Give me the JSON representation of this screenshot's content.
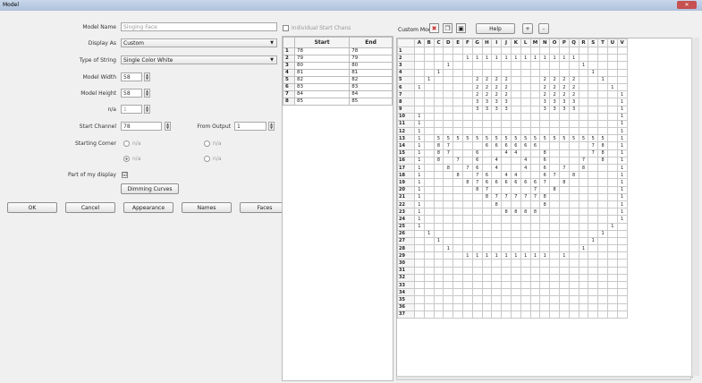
{
  "window": {
    "title": "Model",
    "close": "✕"
  },
  "form": {
    "model_name_label": "Model Name",
    "model_name_value": "Singing Face",
    "display_as_label": "Display As",
    "display_as_value": "Custom",
    "string_type_label": "Type of String",
    "string_type_value": "Single Color White",
    "width_label": "Model Width",
    "width_value": "58",
    "height_label": "Model Height",
    "height_value": "58",
    "na_label": "n/a",
    "na_value": "1",
    "start_channel_label": "Start Channel",
    "start_channel_value": "78",
    "from_output_label": "From Output",
    "from_output_value": "1",
    "starting_corner_label": "Starting Corner",
    "radio_na": "n/a",
    "part_of_display_label": "Part of my display",
    "part_of_display_check": "☑",
    "dimming_button": "Dimming Curves",
    "individual_start_label": "Individual Start Chans"
  },
  "buttons": {
    "ok": "OK",
    "cancel": "Cancel",
    "appearance": "Appearance",
    "names": "Names",
    "faces": "Faces"
  },
  "start_table": {
    "headers": [
      "",
      "Start",
      "End"
    ],
    "rows": [
      [
        "1",
        "78",
        "78"
      ],
      [
        "2",
        "79",
        "79"
      ],
      [
        "3",
        "80",
        "80"
      ],
      [
        "4",
        "81",
        "81"
      ],
      [
        "5",
        "82",
        "82"
      ],
      [
        "6",
        "83",
        "83"
      ],
      [
        "7",
        "84",
        "84"
      ],
      [
        "8",
        "85",
        "85"
      ]
    ]
  },
  "custom": {
    "label": "Custom Model",
    "help": "Help",
    "plus": "+",
    "minus": "-",
    "columns": [
      "A",
      "B",
      "C",
      "D",
      "E",
      "F",
      "G",
      "H",
      "I",
      "J",
      "K",
      "L",
      "M",
      "N",
      "O",
      "P",
      "Q",
      "R",
      "S",
      "T",
      "U",
      "V"
    ],
    "rows": [
      {
        "n": "1",
        "cells": {}
      },
      {
        "n": "2",
        "cells": {
          "F": "1",
          "G": "1",
          "H": "1",
          "I": "1",
          "J": "1",
          "K": "1",
          "L": "1",
          "M": "1",
          "N": "1",
          "O": "1",
          "P": "1",
          "Q": "1"
        }
      },
      {
        "n": "3",
        "cells": {
          "D": "1",
          "R": "1"
        }
      },
      {
        "n": "4",
        "cells": {
          "C": "1",
          "S": "1"
        }
      },
      {
        "n": "5",
        "cells": {
          "B": "1",
          "G": "2",
          "H": "2",
          "I": "2",
          "J": "2",
          "N": "2",
          "O": "2",
          "P": "2",
          "Q": "2",
          "T": "1"
        }
      },
      {
        "n": "6",
        "cells": {
          "A": "1",
          "G": "2",
          "H": "2",
          "I": "2",
          "J": "2",
          "N": "2",
          "O": "2",
          "P": "2",
          "Q": "2",
          "U": "1"
        }
      },
      {
        "n": "7",
        "cells": {
          "G": "2",
          "H": "2",
          "I": "2",
          "J": "2",
          "N": "2",
          "O": "2",
          "P": "2",
          "Q": "2",
          "V": "1"
        }
      },
      {
        "n": "8",
        "cells": {
          "G": "3",
          "H": "3",
          "I": "3",
          "J": "3",
          "N": "3",
          "O": "3",
          "P": "3",
          "Q": "3",
          "V": "1"
        }
      },
      {
        "n": "9",
        "cells": {
          "G": "3",
          "H": "3",
          "I": "3",
          "J": "3",
          "N": "3",
          "O": "3",
          "P": "3",
          "Q": "3",
          "V": "1"
        }
      },
      {
        "n": "10",
        "cells": {
          "A": "1",
          "V": "1"
        }
      },
      {
        "n": "11",
        "cells": {
          "A": "1",
          "V": "1"
        }
      },
      {
        "n": "12",
        "cells": {
          "A": "1",
          "V": "1"
        }
      },
      {
        "n": "13",
        "cells": {
          "A": "1",
          "C": "5",
          "D": "5",
          "E": "5",
          "F": "5",
          "G": "5",
          "H": "5",
          "I": "5",
          "J": "5",
          "K": "5",
          "L": "5",
          "M": "5",
          "N": "5",
          "O": "5",
          "P": "5",
          "Q": "5",
          "R": "5",
          "S": "5",
          "T": "5",
          "V": "1"
        }
      },
      {
        "n": "14",
        "cells": {
          "A": "1",
          "C": "8",
          "D": "7",
          "H": "6",
          "I": "6",
          "J": "6",
          "K": "6",
          "L": "6",
          "M": "6",
          "S": "7",
          "T": "8",
          "V": "1"
        }
      },
      {
        "n": "15",
        "cells": {
          "A": "1",
          "C": "8",
          "D": "7",
          "G": "6",
          "J": "4",
          "K": "4",
          "N": "8",
          "S": "7",
          "T": "8",
          "V": "1"
        }
      },
      {
        "n": "16",
        "cells": {
          "A": "1",
          "C": "8",
          "E": "7",
          "G": "6",
          "I": "4",
          "L": "4",
          "N": "6",
          "R": "7",
          "T": "8",
          "V": "1"
        }
      },
      {
        "n": "17",
        "cells": {
          "A": "1",
          "D": "8",
          "F": "7",
          "G": "6",
          "I": "4",
          "L": "4",
          "N": "6",
          "P": "7",
          "R": "8",
          "V": "1"
        }
      },
      {
        "n": "18",
        "cells": {
          "A": "1",
          "E": "8",
          "G": "7",
          "H": "6",
          "J": "4",
          "K": "4",
          "N": "6",
          "O": "7",
          "Q": "8",
          "V": "1"
        }
      },
      {
        "n": "19",
        "cells": {
          "A": "1",
          "F": "8",
          "G": "7",
          "H": "6",
          "I": "6",
          "J": "6",
          "K": "6",
          "L": "6",
          "M": "6",
          "N": "7",
          "P": "8",
          "V": "1"
        }
      },
      {
        "n": "20",
        "cells": {
          "A": "1",
          "G": "8",
          "H": "7",
          "M": "7",
          "O": "8",
          "V": "1"
        }
      },
      {
        "n": "21",
        "cells": {
          "A": "1",
          "H": "8",
          "I": "7",
          "J": "7",
          "K": "7",
          "L": "7",
          "M": "7",
          "N": "8",
          "V": "1"
        }
      },
      {
        "n": "22",
        "cells": {
          "A": "1",
          "I": "8",
          "N": "8",
          "V": "1"
        }
      },
      {
        "n": "23",
        "cells": {
          "A": "1",
          "J": "8",
          "K": "8",
          "L": "8",
          "M": "8",
          "V": "1"
        }
      },
      {
        "n": "24",
        "cells": {
          "A": "1",
          "V": "1"
        }
      },
      {
        "n": "25",
        "cells": {
          "A": "1",
          "U": "1"
        }
      },
      {
        "n": "26",
        "cells": {
          "B": "1",
          "T": "1"
        }
      },
      {
        "n": "27",
        "cells": {
          "C": "1",
          "S": "1"
        }
      },
      {
        "n": "28",
        "cells": {
          "D": "1",
          "R": "1"
        }
      },
      {
        "n": "29",
        "cells": {
          "F": "1",
          "G": "1",
          "H": "1",
          "I": "1",
          "J": "1",
          "K": "1",
          "L": "1",
          "M": "1",
          "N": "1",
          "P": "1"
        }
      },
      {
        "n": "30",
        "cells": {}
      },
      {
        "n": "31",
        "cells": {}
      },
      {
        "n": "32",
        "cells": {}
      },
      {
        "n": "33",
        "cells": {}
      },
      {
        "n": "34",
        "cells": {}
      },
      {
        "n": "35",
        "cells": {}
      },
      {
        "n": "36",
        "cells": {}
      },
      {
        "n": "37",
        "cells": {}
      }
    ]
  }
}
